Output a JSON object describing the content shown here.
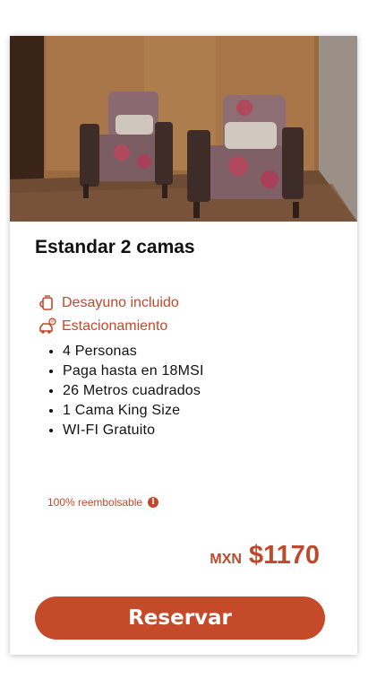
{
  "room": {
    "title": "Estandar 2 camas"
  },
  "amenities": [
    {
      "icon": "coffee-cup-icon",
      "label": "Desayuno incluido"
    },
    {
      "icon": "car-parking-icon",
      "label": "Estacionamiento"
    }
  ],
  "features": [
    "4 Personas",
    "Paga hasta en 18MSI",
    "26 Metros cuadrados",
    "1 Cama King Size",
    "WI-FI Gratuito"
  ],
  "refund": {
    "label": "100% reembolsable",
    "icon": "info-icon"
  },
  "price": {
    "currency": "MXN",
    "amount": "$1170"
  },
  "actions": {
    "reserve_label": "Reservar"
  },
  "colors": {
    "accent": "#c0492b",
    "button": "#c44a2a"
  }
}
